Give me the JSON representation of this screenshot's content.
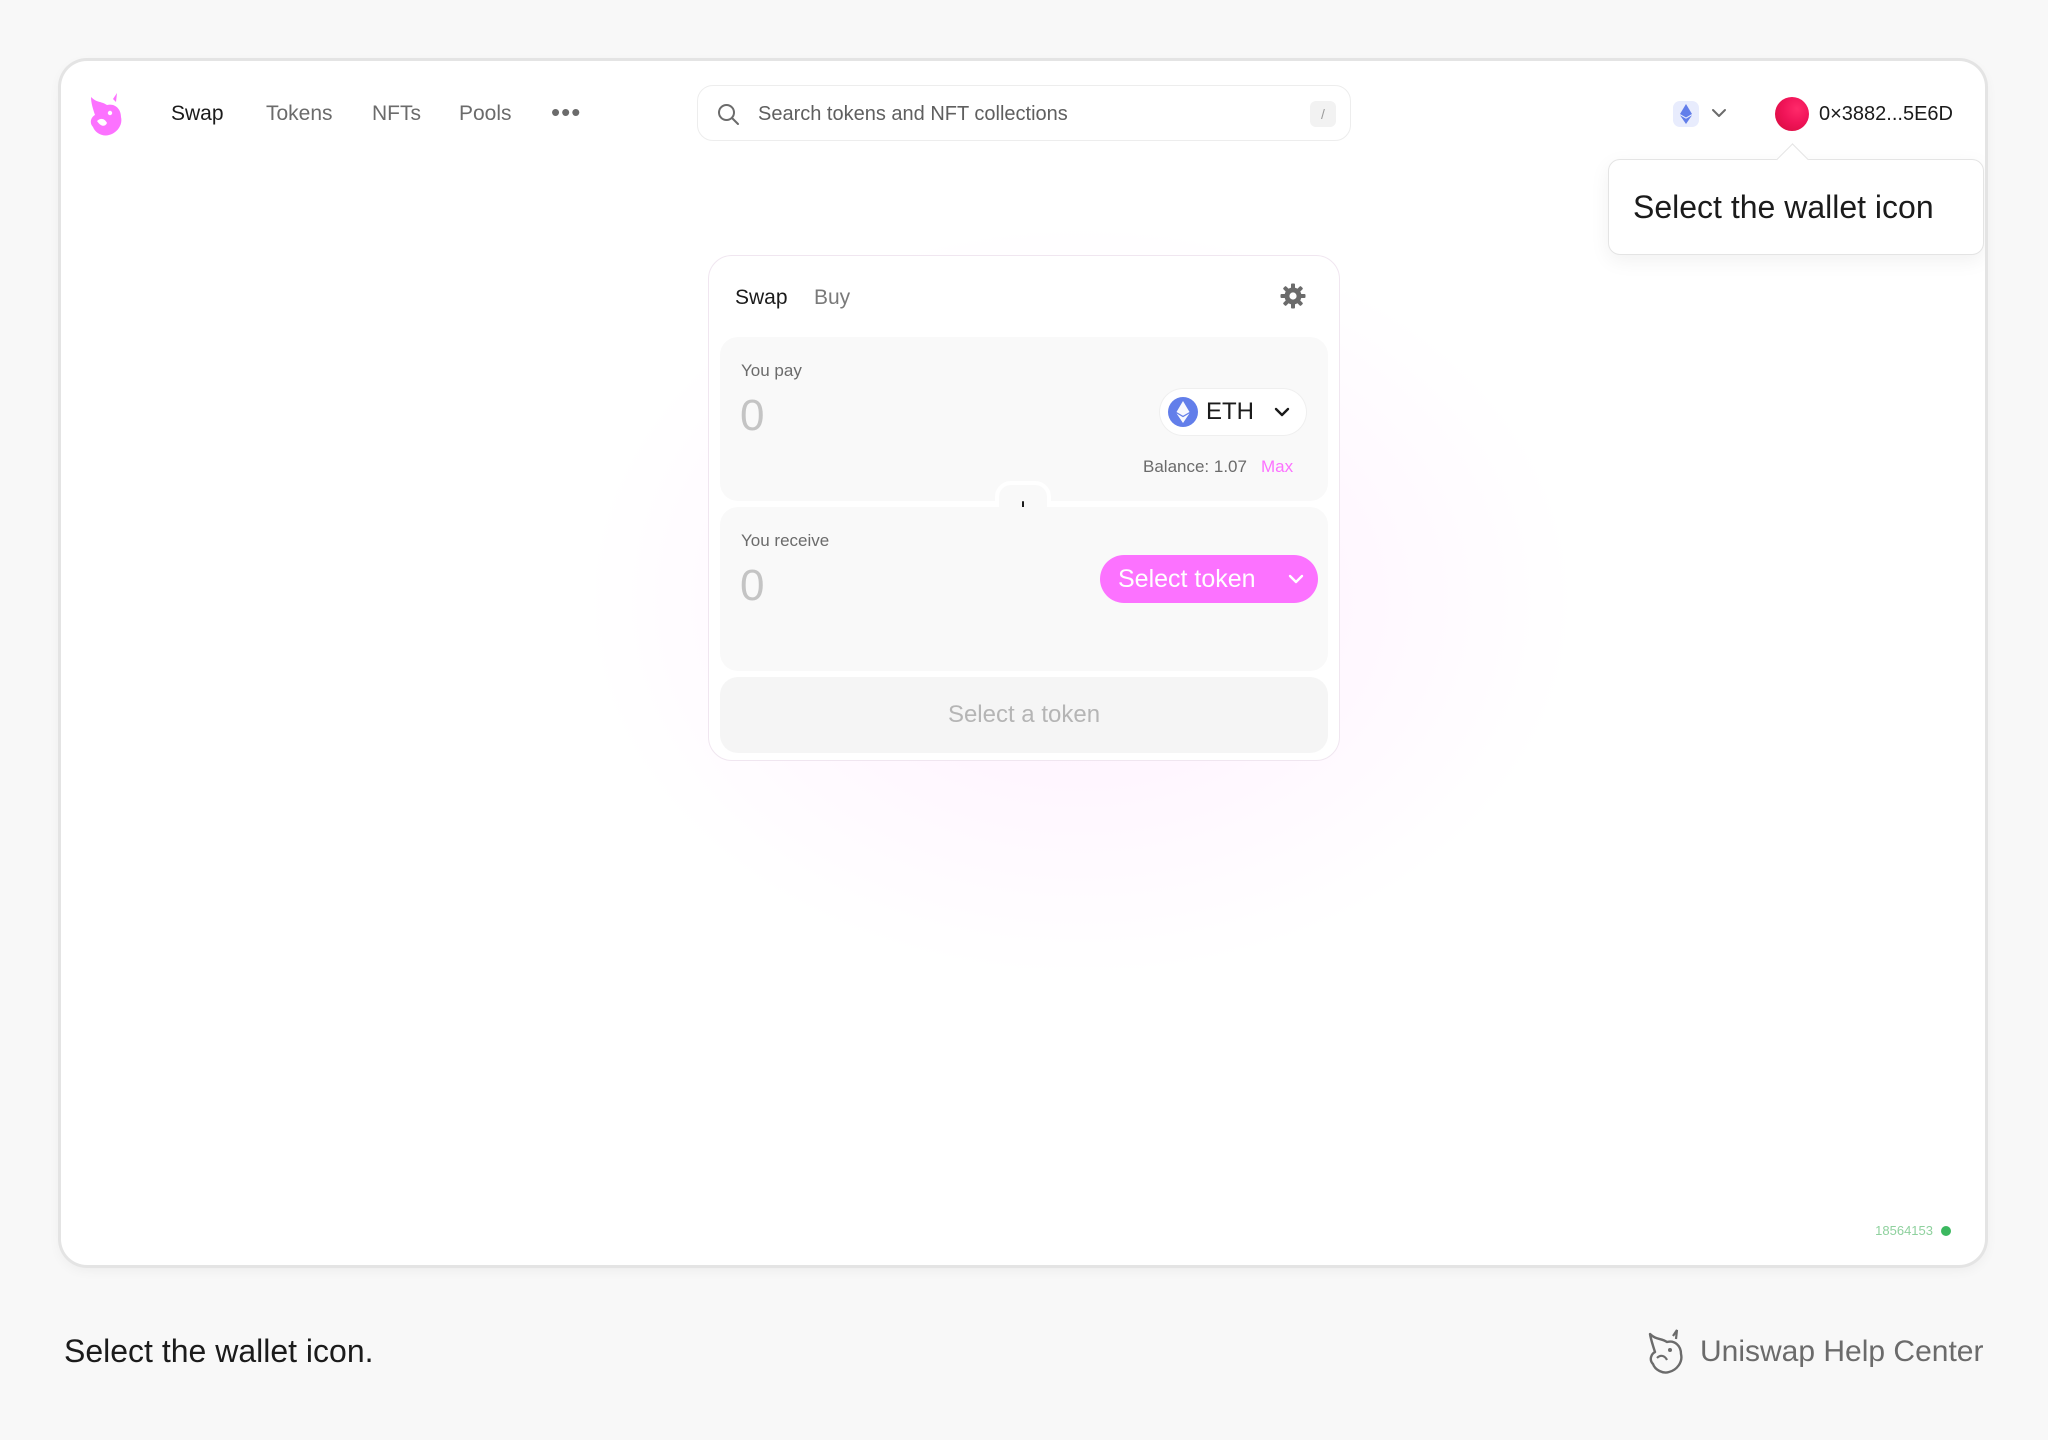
{
  "navbar": {
    "links": [
      "Swap",
      "Tokens",
      "NFTs",
      "Pools"
    ],
    "more_label": "•••",
    "search_placeholder": "Search tokens and NFT collections",
    "search_shortcut": "/",
    "wallet_address": "0×3882...5E6D"
  },
  "tooltip": {
    "text": "Select the wallet icon"
  },
  "swap": {
    "tabs": [
      "Swap",
      "Buy"
    ],
    "pay": {
      "label": "You pay",
      "amount": "0",
      "token": "ETH",
      "balance": "Balance: 1.07",
      "max_label": "Max"
    },
    "receive": {
      "label": "You receive",
      "amount": "0",
      "select_label": "Select token"
    },
    "cta_label": "Select a token"
  },
  "status": {
    "block_number": "18564153"
  },
  "footer": {
    "caption": "Select the wallet icon.",
    "brand": "Uniswap Help Center"
  },
  "colors": {
    "accent": "#fc72ff",
    "wallet_avatar": "#f01458",
    "status_dot": "#3bb85f"
  }
}
